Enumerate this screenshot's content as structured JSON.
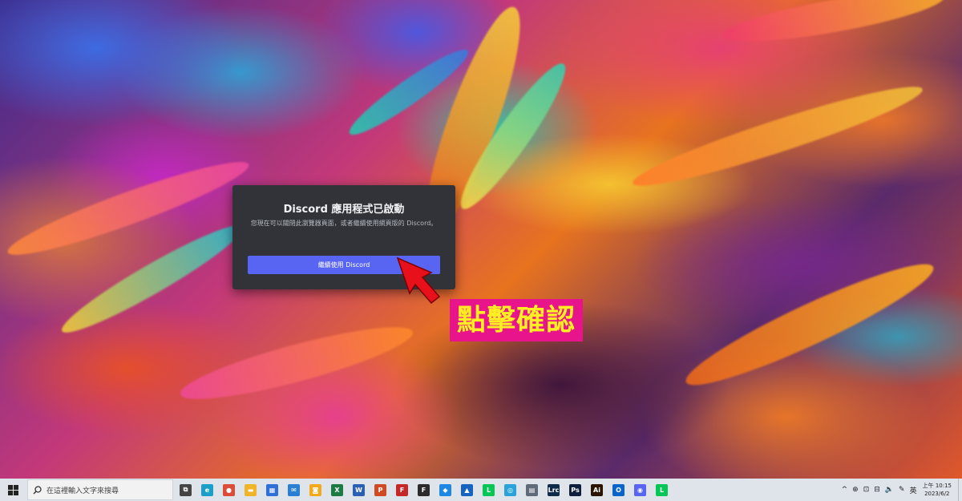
{
  "dialog": {
    "title": "Discord 應用程式已啟動",
    "body": "您現在可以關閉此瀏覽器頁面，或者繼續使用網頁版的 Discord。",
    "button_label": "繼續使用 Discord"
  },
  "annotation": {
    "label": "點擊確認",
    "label_bg": "#e8148c",
    "label_fg": "#ffee22",
    "arrow_color": "#e8101a"
  },
  "taskbar": {
    "search_placeholder": "在這裡輸入文字來搜尋",
    "apps": [
      {
        "name": "task-view",
        "glyph": "⧉",
        "color": "#444444"
      },
      {
        "name": "edge",
        "glyph": "e",
        "color": "#1aa0c8"
      },
      {
        "name": "chrome",
        "glyph": "●",
        "color": "#dd4b39"
      },
      {
        "name": "file-explorer",
        "glyph": "▬",
        "color": "#f0b429"
      },
      {
        "name": "microsoft-store",
        "glyph": "▦",
        "color": "#2f6fd6"
      },
      {
        "name": "mail",
        "glyph": "✉",
        "color": "#2a7fd4"
      },
      {
        "name": "folder-app",
        "glyph": "◙",
        "color": "#f2a91c"
      },
      {
        "name": "excel",
        "glyph": "X",
        "color": "#1d7a43"
      },
      {
        "name": "word",
        "glyph": "W",
        "color": "#2b5fb3"
      },
      {
        "name": "powerpoint",
        "glyph": "P",
        "color": "#d04a23"
      },
      {
        "name": "filezilla",
        "glyph": "F",
        "color": "#c62828"
      },
      {
        "name": "font-app",
        "glyph": "F",
        "color": "#2b2b2b"
      },
      {
        "name": "app-blue",
        "glyph": "◆",
        "color": "#1e88e5"
      },
      {
        "name": "app-printer",
        "glyph": "▲",
        "color": "#1565c0"
      },
      {
        "name": "line",
        "glyph": "L",
        "color": "#06c755"
      },
      {
        "name": "browser-globe",
        "glyph": "◎",
        "color": "#29a3d9"
      },
      {
        "name": "calculator",
        "glyph": "▤",
        "color": "#5f6b7a"
      },
      {
        "name": "lightroom-classic",
        "glyph": "Lrc",
        "color": "#0e2b4a"
      },
      {
        "name": "photoshop",
        "glyph": "Ps",
        "color": "#0f1e3c"
      },
      {
        "name": "illustrator",
        "glyph": "Ai",
        "color": "#2b1400"
      },
      {
        "name": "outlook",
        "glyph": "O",
        "color": "#0a64c9"
      },
      {
        "name": "discord",
        "glyph": "◉",
        "color": "#5865f2"
      },
      {
        "name": "line-2",
        "glyph": "L",
        "color": "#06c755"
      }
    ],
    "tray": {
      "chevron": "^",
      "icons": [
        "⊕",
        "⊡",
        "⊟",
        "🔈",
        "✎"
      ],
      "ime": "英",
      "time_line1": "上午 10:15",
      "time_line2": "2023/6/2"
    }
  }
}
